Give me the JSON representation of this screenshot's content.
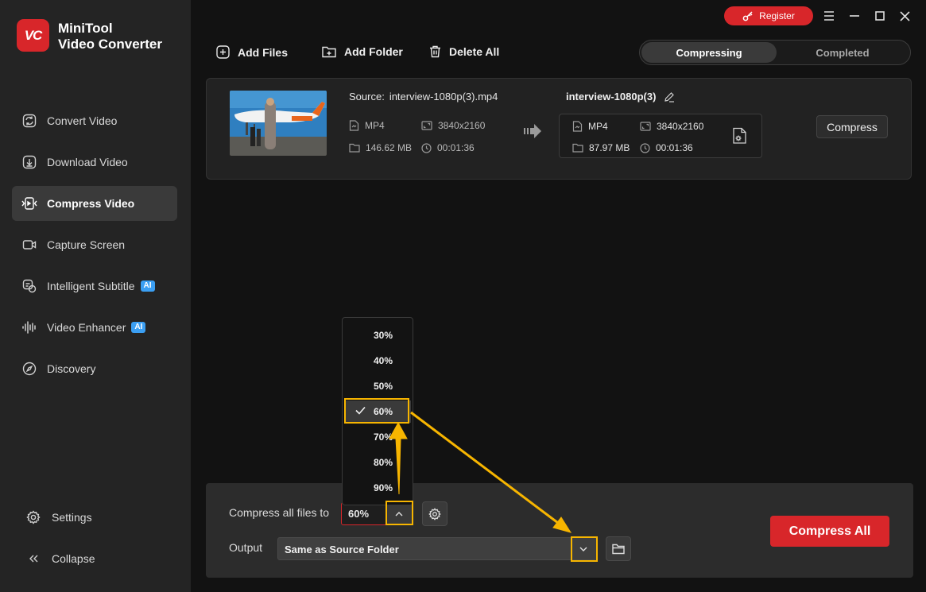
{
  "app": {
    "logo_text": "VC",
    "brand_line1": "MiniTool",
    "brand_line2": "Video Converter",
    "accent_color": "#d8262a"
  },
  "sidebar": {
    "items": [
      {
        "label": "Convert Video",
        "icon": "convert-icon"
      },
      {
        "label": "Download Video",
        "icon": "download-icon"
      },
      {
        "label": "Compress Video",
        "icon": "compress-icon",
        "active": true
      },
      {
        "label": "Capture Screen",
        "icon": "camera-icon"
      },
      {
        "label": "Intelligent Subtitle",
        "icon": "subtitle-icon",
        "badge": "AI"
      },
      {
        "label": "Video Enhancer",
        "icon": "waveform-icon",
        "badge": "AI"
      },
      {
        "label": "Discovery",
        "icon": "compass-icon"
      }
    ],
    "settings_label": "Settings",
    "collapse_label": "Collapse"
  },
  "window": {
    "register_label": "Register"
  },
  "toolbar": {
    "add_files": "Add Files",
    "add_folder": "Add Folder",
    "delete_all": "Delete All",
    "tab_compressing": "Compressing",
    "tab_completed": "Completed"
  },
  "file": {
    "source_label": "Source:",
    "source_name": "interview-1080p(3).mp4",
    "source_format": "MP4",
    "source_resolution": "3840x2160",
    "source_size": "146.62 MB",
    "source_duration": "00:01:36",
    "target_name": "interview-1080p(3)",
    "target_format": "MP4",
    "target_resolution": "3840x2160",
    "target_size": "87.97 MB",
    "target_duration": "00:01:36",
    "compress_label": "Compress"
  },
  "panel": {
    "compress_label": "Compress all files to",
    "compress_value": "60%",
    "output_label": "Output",
    "output_value": "Same as Source Folder",
    "compress_all_label": "Compress All"
  },
  "menu": {
    "options": [
      "30%",
      "40%",
      "50%",
      "60%",
      "70%",
      "80%",
      "90%"
    ],
    "selected": "60%"
  },
  "annotation_color": "#f7b500"
}
